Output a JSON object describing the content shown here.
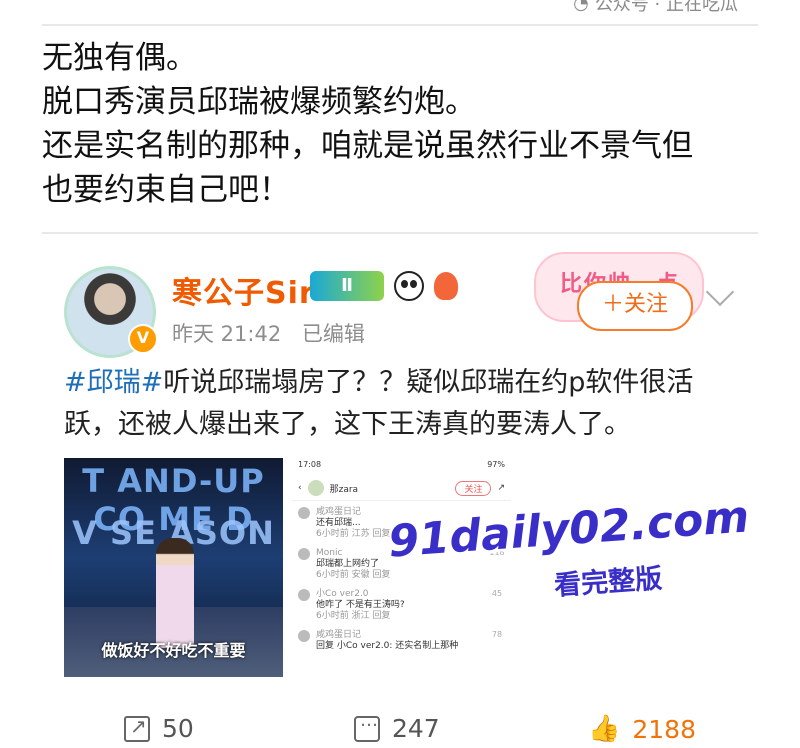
{
  "watermark_top": "公众号 · 正在吃瓜",
  "caption": {
    "line1": "无独有偶。",
    "line2": "脱口秀演员邱瑞被爆频繁约炮。",
    "line3": "还是实名制的那种，咱就是说虽然行业不景气但",
    "line4": "也要约束自己吧！"
  },
  "post": {
    "username": "寒公子Sir",
    "level_badge": "Ⅱ",
    "verified": "V",
    "time": "昨天 21:42",
    "edited": "已编辑",
    "decoration_text": "比你帅一点",
    "follow_label": "＋关注",
    "hashtag": "#邱瑞#",
    "body": "听说邱瑞塌房了？？疑似邱瑞在约p软件很活跃，还被人爆出来了，这下王涛真的要涛人了。",
    "image1": {
      "stage_sign_1": "T AND-UP CO ME D",
      "stage_sign_2": "V  SE ASON 5",
      "subtitle": "做饭好不好吃不重要"
    },
    "image2": {
      "status": "17:08",
      "battery": "97%",
      "account": "那zara",
      "follow": "关注",
      "comments": [
        {
          "user": "咸鸡蛋日记",
          "text": "还有邱瑞...",
          "meta": "6小时前 江苏 回复",
          "count": ""
        },
        {
          "user": "Monic",
          "text": "邱瑞都上网约了",
          "meta": "6小时前 安徽 回复",
          "count": "118"
        },
        {
          "user": "小Co ver2.0",
          "text": "他咋了 不是有王涛吗?",
          "meta": "6小时前 浙江 回复",
          "count": "45"
        },
        {
          "user": "咸鸡蛋日记",
          "text": "回复 小Co ver2.0: 还实名制上那种",
          "meta": "",
          "count": "78"
        }
      ]
    },
    "overlay_watermark": "91daily02.com",
    "overlay_sub": "看完整版",
    "actions": {
      "reposts": "50",
      "comments": "247",
      "likes": "2188"
    }
  }
}
